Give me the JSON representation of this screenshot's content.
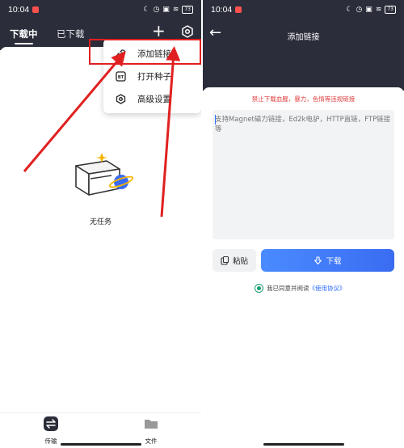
{
  "left": {
    "status": {
      "time": "10:04",
      "battery": "73"
    },
    "tabs": {
      "downloading": "下载中",
      "downloaded": "已下载"
    },
    "menu": {
      "items": [
        {
          "label": "添加链接",
          "icon": "link-icon"
        },
        {
          "label": "打开种子",
          "icon": "bt-icon"
        },
        {
          "label": "高级设置",
          "icon": "settings-hex-icon"
        }
      ]
    },
    "empty_text": "无任务",
    "nav": {
      "transfer": "传输",
      "files": "文件"
    }
  },
  "right": {
    "status": {
      "time": "10:04",
      "battery": "73"
    },
    "title": "添加链接",
    "warning": "禁止下载血腥，暴力，色情等违规链接",
    "input": {
      "placeholder": "支持Magnet磁力链接，Ed2k电驴，HTTP直链，FTP链接等"
    },
    "paste_label": "粘贴",
    "download_label": "下载",
    "agree_text": "我已同意并阅读",
    "agree_link": "《使用协议》"
  },
  "colors": {
    "header_bg": "#2b2d3a",
    "accent": "#3a6cf2",
    "warning": "#e04040",
    "highlight": "#e02020",
    "agree": "#1a9e6e"
  }
}
